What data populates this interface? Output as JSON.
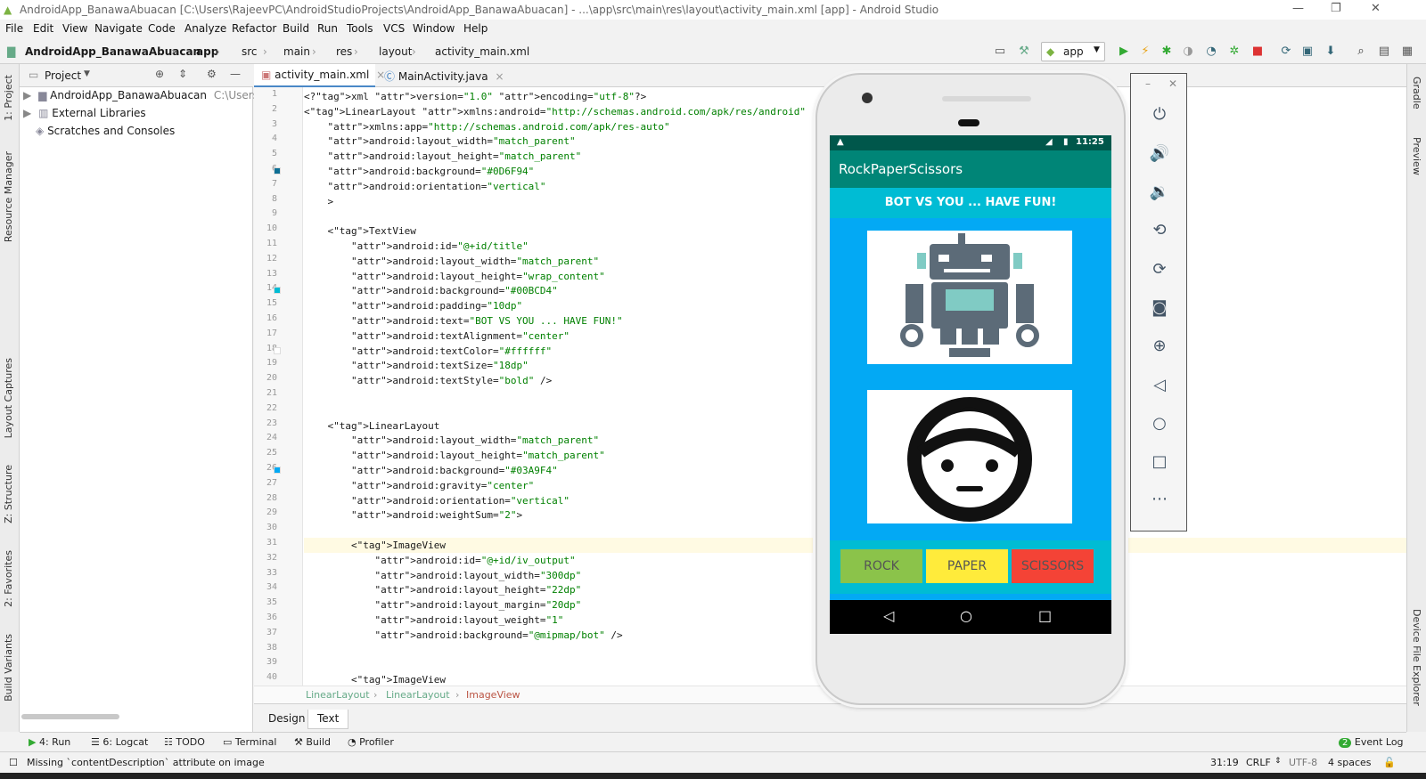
{
  "window": {
    "title": "AndroidApp_BanawaAbuacan [C:\\Users\\RajeevPC\\AndroidStudioProjects\\AndroidApp_BanawaAbuacan] - ...\\app\\src\\main\\res\\layout\\activity_main.xml [app] - Android Studio"
  },
  "menu": [
    "File",
    "Edit",
    "View",
    "Navigate",
    "Code",
    "Analyze",
    "Refactor",
    "Build",
    "Run",
    "Tools",
    "VCS",
    "Window",
    "Help"
  ],
  "breadcrumb": [
    "AndroidApp_BanawaAbuacan",
    "app",
    "src",
    "main",
    "res",
    "layout",
    "activity_main.xml"
  ],
  "toolbar": {
    "run_config": "app"
  },
  "left_tabs": [
    "1: Project",
    "Resource Manager",
    "Layout Captures",
    "Z: Structure",
    "2: Favorites",
    "Build Variants"
  ],
  "right_tabs": [
    "Gradle",
    "Preview",
    "Device File Explorer"
  ],
  "project": {
    "view_label": "Project",
    "tree": [
      {
        "label": "AndroidApp_BanawaAbuacan",
        "hint": "C:\\Users\\R"
      },
      {
        "label": "External Libraries",
        "hint": ""
      },
      {
        "label": "Scratches and Consoles",
        "hint": ""
      }
    ]
  },
  "editor": {
    "tabs": [
      "activity_main.xml",
      "MainActivity.java"
    ],
    "lines": [
      "<?xml version=\"1.0\" encoding=\"utf-8\"?>",
      "<LinearLayout xmlns:android=\"http://schemas.android.com/apk/res/android\"",
      "    xmlns:app=\"http://schemas.android.com/apk/res-auto\"",
      "    android:layout_width=\"match_parent\"",
      "    android:layout_height=\"match_parent\"",
      "    android:background=\"#0D6F94\"",
      "    android:orientation=\"vertical\"",
      "    >",
      "",
      "    <TextView",
      "        android:id=\"@+id/title\"",
      "        android:layout_width=\"match_parent\"",
      "        android:layout_height=\"wrap_content\"",
      "        android:background=\"#00BCD4\"",
      "        android:padding=\"10dp\"",
      "        android:text=\"BOT VS YOU ... HAVE FUN!\"",
      "        android:textAlignment=\"center\"",
      "        android:textColor=\"#ffffff\"",
      "        android:textSize=\"18dp\"",
      "        android:textStyle=\"bold\" />",
      "",
      "",
      "    <LinearLayout",
      "        android:layout_width=\"match_parent\"",
      "        android:layout_height=\"match_parent\"",
      "        android:background=\"#03A9F4\"",
      "        android:gravity=\"center\"",
      "        android:orientation=\"vertical\"",
      "        android:weightSum=\"2\">",
      "",
      "        <ImageView",
      "            android:id=\"@+id/iv_output\"",
      "            android:layout_width=\"300dp\"",
      "            android:layout_height=\"22dp\"",
      "            android:layout_margin=\"20dp\"",
      "            android:layout_weight=\"1\"",
      "            android:background=\"@mipmap/bot\" />",
      "",
      "",
      "        <ImageView"
    ],
    "breadcrumbs": [
      "LinearLayout",
      "LinearLayout",
      "ImageView"
    ],
    "bottom_tabs": [
      "Design",
      "Text"
    ]
  },
  "emulator": {
    "status_time": "11:25",
    "app_title": "RockPaperScissors",
    "banner": "BOT VS YOU ... HAVE FUN!",
    "buttons": [
      {
        "label": "ROCK",
        "color": "#8bc34a"
      },
      {
        "label": "PAPER",
        "color": "#ffeb3b"
      },
      {
        "label": "SCISSORS",
        "color": "#f44336"
      }
    ],
    "controls": [
      "power-icon",
      "volume-up-icon",
      "volume-down-icon",
      "rotate-left-icon",
      "rotate-right-icon",
      "camera-icon",
      "zoom-icon",
      "back-icon",
      "home-icon",
      "overview-icon",
      "more-icon"
    ]
  },
  "bottom_tools": [
    "4: Run",
    "6: Logcat",
    "TODO",
    "Terminal",
    "Build",
    "Profiler"
  ],
  "event_log": {
    "count": "2",
    "label": "Event Log"
  },
  "status": {
    "message": "Missing `contentDescription` attribute on image",
    "position": "31:19",
    "line_sep": "CRLF",
    "encoding": "UTF-8",
    "indent": "4 spaces"
  }
}
